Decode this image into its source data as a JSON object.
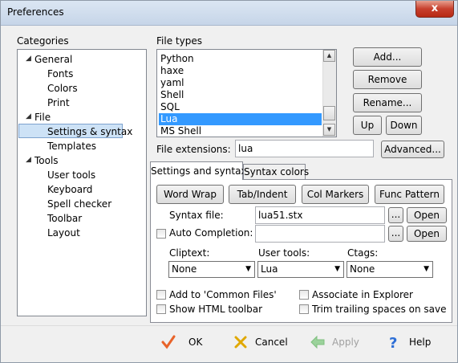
{
  "window": {
    "title": "Preferences",
    "close_glyph": "x"
  },
  "categories": {
    "label": "Categories",
    "items": [
      {
        "label": "General",
        "expandable": true
      },
      {
        "label": "Fonts"
      },
      {
        "label": "Colors"
      },
      {
        "label": "Print"
      },
      {
        "label": "File",
        "expandable": true
      },
      {
        "label": "Settings & syntax",
        "selected": true
      },
      {
        "label": "Templates"
      },
      {
        "label": "Tools",
        "expandable": true
      },
      {
        "label": "User tools"
      },
      {
        "label": "Keyboard"
      },
      {
        "label": "Spell checker"
      },
      {
        "label": "Toolbar"
      },
      {
        "label": "Layout"
      }
    ]
  },
  "file_types": {
    "label": "File types",
    "items": [
      "Python",
      "haxe",
      "yaml",
      "Shell",
      "SQL",
      "Lua",
      "MS Shell"
    ],
    "selected": "Lua"
  },
  "buttons": {
    "add": "Add...",
    "remove": "Remove",
    "rename": "Rename...",
    "up": "Up",
    "down": "Down",
    "advanced": "Advanced..."
  },
  "file_extensions": {
    "label": "File extensions:",
    "value": "lua"
  },
  "tabs": {
    "settings": "Settings and syntax",
    "colors": "Syntax colors"
  },
  "settings": {
    "word_wrap": "Word Wrap",
    "tab_indent": "Tab/Indent",
    "col_markers": "Col Markers",
    "func_pattern": "Func Pattern",
    "syntax_file_label": "Syntax file:",
    "syntax_file_value": "lua51.stx",
    "browse": "...",
    "open": "Open",
    "auto_completion": "Auto Completion:",
    "auto_completion_value": "",
    "cliptext_label": "Cliptext:",
    "cliptext_value": "None",
    "user_tools_label": "User tools:",
    "user_tools_value": "Lua",
    "ctags_label": "Ctags:",
    "ctags_value": "None",
    "add_common": "Add to 'Common Files'",
    "show_html": "Show HTML toolbar",
    "associate": "Associate in Explorer",
    "trim_trailing": "Trim trailing spaces on save"
  },
  "footer": {
    "ok": "OK",
    "cancel": "Cancel",
    "apply": "Apply",
    "help": "Help",
    "colors": {
      "ok": "#e8632a",
      "cancel": "#e0a800",
      "apply": "#9bd29b",
      "help": "#2e6fd6"
    }
  }
}
